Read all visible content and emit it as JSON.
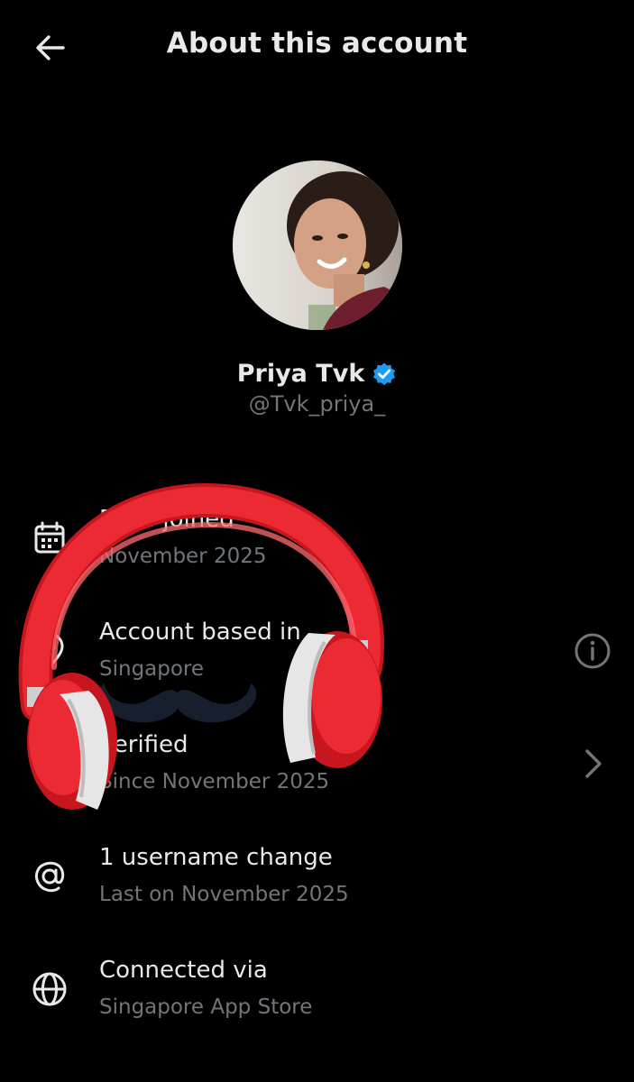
{
  "header": {
    "title": "About this account",
    "back_icon": "arrow-left-icon"
  },
  "profile": {
    "display_name": "Priya Tvk",
    "handle": "@Tvk_priya_",
    "verified_badge_color": "#1d9bf0"
  },
  "rows": [
    {
      "label": "Date joined",
      "value": "November 2025",
      "icon": "calendar-icon"
    },
    {
      "label": "Account based in",
      "value": "Singapore",
      "icon": "location-pin-icon",
      "right_icon": "info-icon"
    },
    {
      "label": "Verified",
      "value": "Since November 2025",
      "icon": "verified-icon",
      "right_icon": "chevron-right-icon"
    },
    {
      "label": "1 username change",
      "value": "Last on November 2025",
      "icon": "at-sign-icon"
    },
    {
      "label": "Connected via",
      "value": "Singapore App Store",
      "icon": "globe-icon"
    }
  ],
  "overlay": {
    "sticker": "headphones-sticker",
    "sticker_color": "#e8202a",
    "mustache": "mustache-sticker"
  },
  "colors": {
    "background": "#000000",
    "primary_text": "#e7e9ea",
    "secondary_text": "#71767b",
    "accent": "#1d9bf0"
  }
}
